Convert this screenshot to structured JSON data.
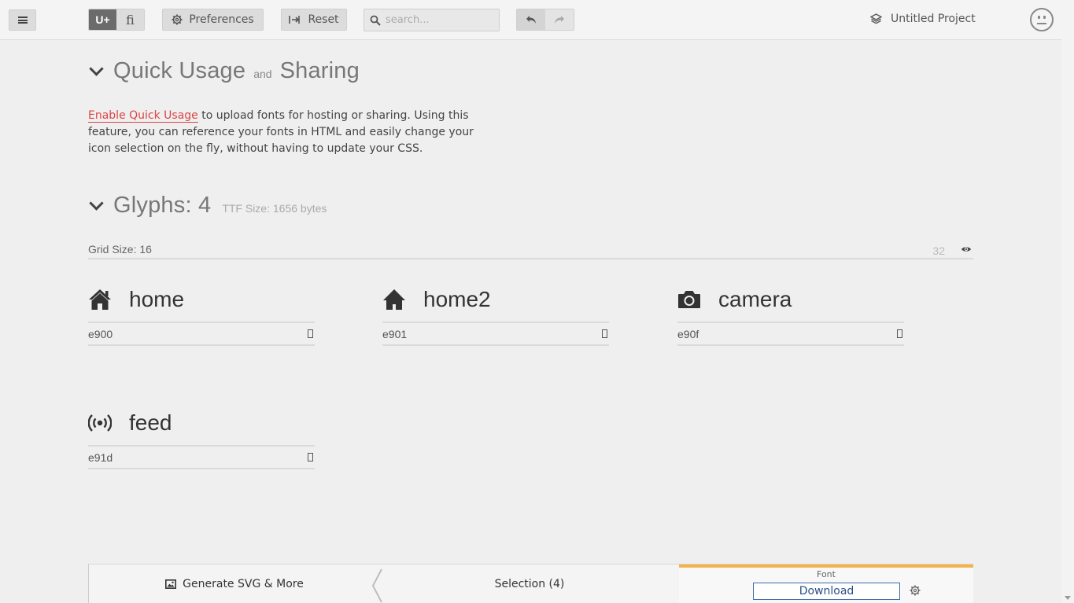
{
  "topbar": {
    "menu_icon": "hamburger-menu-icon",
    "mode_unicode_label": "U+",
    "mode_ligature_label": "fi",
    "preferences_label": "Preferences",
    "reset_label": "Reset",
    "search_placeholder": "search...",
    "project_name": "Untitled Project"
  },
  "quick_usage": {
    "title_part1": "Quick Usage",
    "title_and": "and",
    "title_part2": "Sharing",
    "link_text": "Enable Quick Usage",
    "body_text": " to upload fonts for hosting or sharing. Using this feature, you can reference your fonts in HTML and easily change your icon selection on the fly, without having to update your CSS."
  },
  "glyphs": {
    "title": "Glyphs: 4",
    "ttf_size": "TTF Size: 1656 bytes",
    "grid_size_label": "Grid Size: 16",
    "grid_alt": "32",
    "items": [
      {
        "name": "home",
        "code": "e900",
        "icon": "home-icon"
      },
      {
        "name": "home2",
        "code": "e901",
        "icon": "home2-icon"
      },
      {
        "name": "camera",
        "code": "e90f",
        "icon": "camera-icon"
      },
      {
        "name": "feed",
        "code": "e91d",
        "icon": "feed-icon"
      }
    ]
  },
  "bottombar": {
    "generate_label": "Generate SVG & More",
    "selection_label": "Selection (4)",
    "font_label": "Font",
    "download_label": "Download",
    "accent_color": "#f5b24c"
  }
}
